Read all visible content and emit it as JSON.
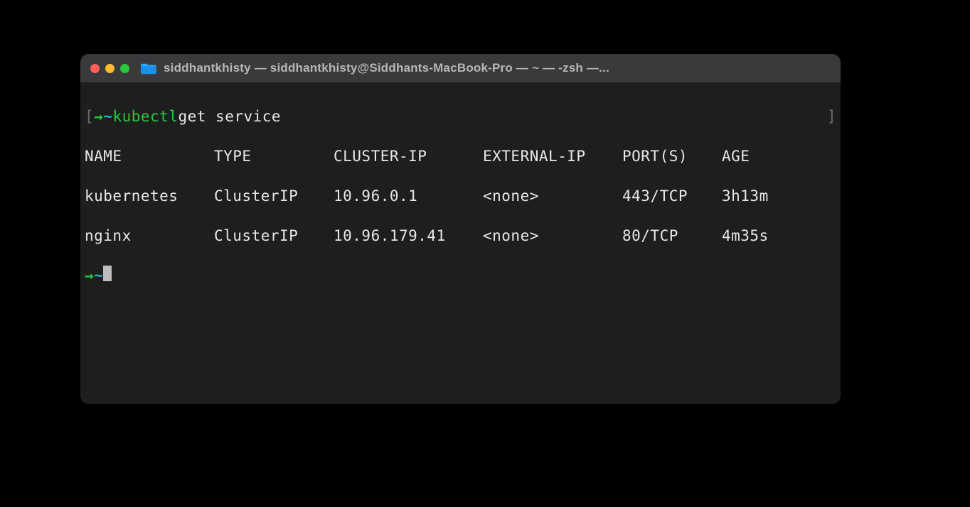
{
  "window": {
    "title": "siddhantkhisty — siddhantkhisty@Siddhants-MacBook-Pro — ~ — -zsh —..."
  },
  "prompt": {
    "open_bracket": "[",
    "close_bracket": "]",
    "arrow": "→",
    "tilde": "~",
    "command": "kubectl",
    "args": "get service"
  },
  "columns": {
    "c0": "NAME",
    "c1": "TYPE",
    "c2": "CLUSTER-IP",
    "c3": "EXTERNAL-IP",
    "c4": "PORT(S)",
    "c5": "AGE"
  },
  "rows": [
    {
      "c0": "kubernetes",
      "c1": "ClusterIP",
      "c2": "10.96.0.1",
      "c3": "<none>",
      "c4": "443/TCP",
      "c5": "3h13m"
    },
    {
      "c0": "nginx",
      "c1": "ClusterIP",
      "c2": "10.96.179.41",
      "c3": "<none>",
      "c4": "80/TCP",
      "c5": "4m35s"
    }
  ]
}
